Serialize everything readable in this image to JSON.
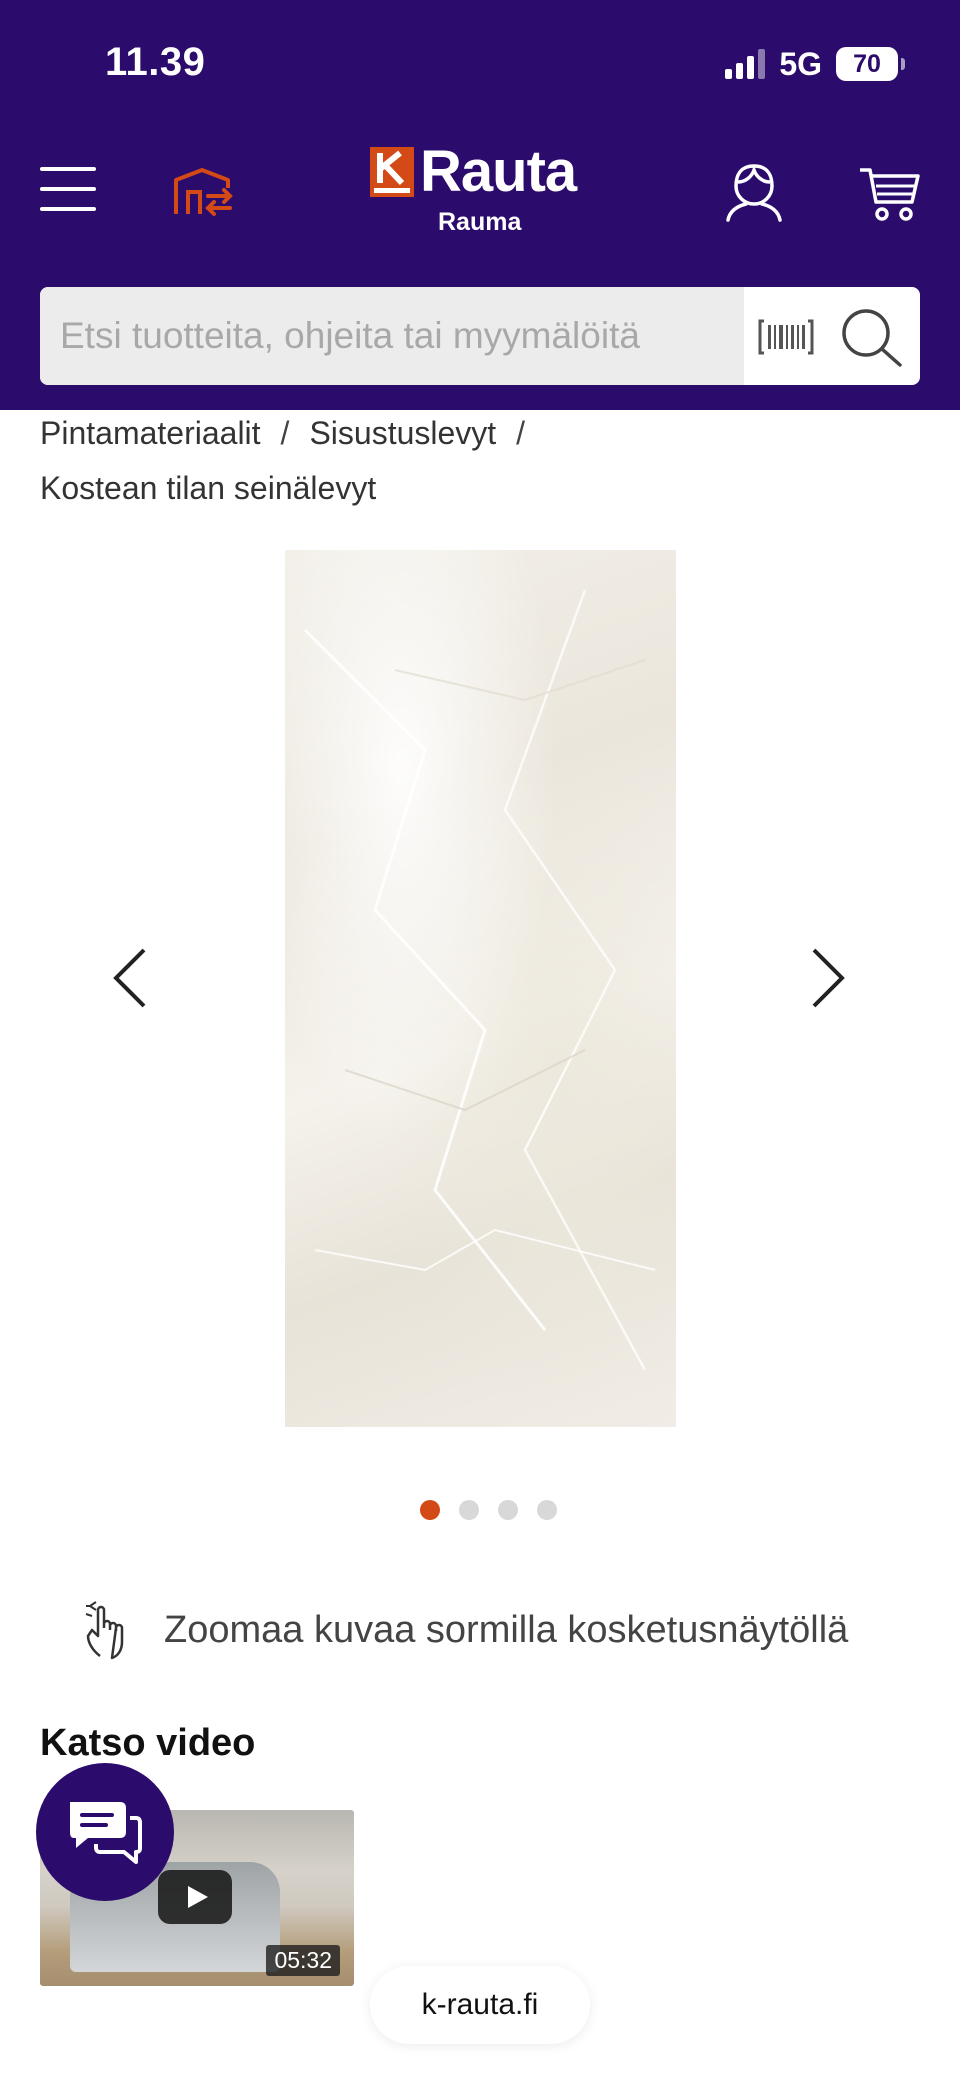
{
  "status_bar": {
    "time": "11.39",
    "network": "5G",
    "battery": "70"
  },
  "header": {
    "brand_letter": "K",
    "brand_name": "Rauta",
    "store_name": "Rauma",
    "accent_color": "#d44a16",
    "background_color": "#2b0b6b"
  },
  "search": {
    "placeholder": "Etsi tuotteita, ohjeita tai myymälöitä",
    "value": ""
  },
  "breadcrumb": {
    "items": [
      "Pintamateriaalit",
      "Sisustuslevyt",
      "Kostean tilan seinälevyt"
    ],
    "separator": "/"
  },
  "carousel": {
    "total_images": 4,
    "active_index": 0
  },
  "zoom_hint": "Zoomaa kuvaa sormilla kosketusnäytöllä",
  "video": {
    "heading": "Katso video",
    "duration": "05:32"
  },
  "browser": {
    "url": "k-rauta.fi"
  }
}
